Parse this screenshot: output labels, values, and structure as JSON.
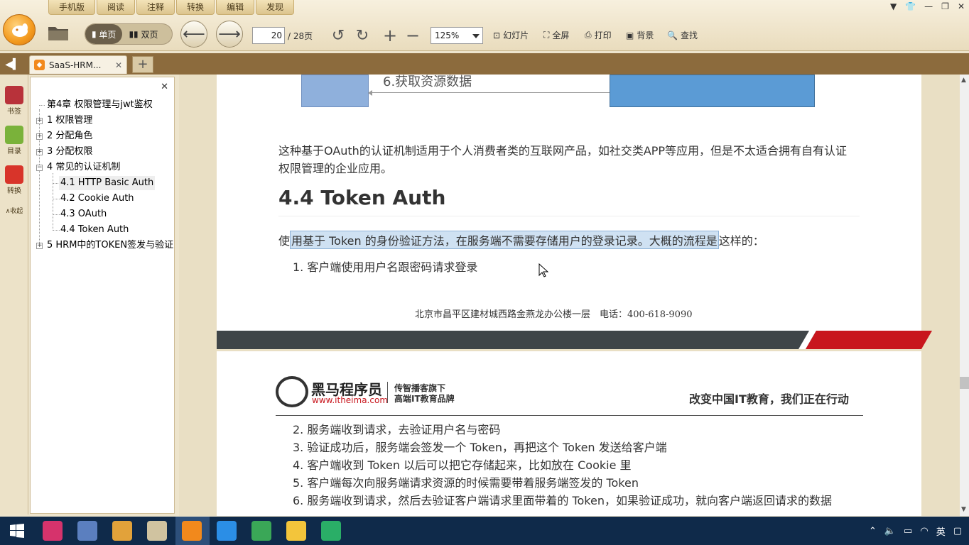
{
  "menu": [
    "手机版",
    "阅读",
    "注释",
    "转换",
    "编辑",
    "发现"
  ],
  "toolbar": {
    "single_page": "单页",
    "double_page": "双页",
    "page_current": "20",
    "page_total": "/ 28页",
    "zoom": "125%",
    "slideshow": "幻灯片",
    "fullscreen": "全屏",
    "print": "打印",
    "background": "背景",
    "find": "查找"
  },
  "tab": {
    "title": "SaaS-HRM...",
    "close": "✕",
    "new": "+"
  },
  "rail": [
    {
      "label": "书签",
      "color": "#b8323a"
    },
    {
      "label": "目录",
      "color": "#7ab23a"
    },
    {
      "label": "转换",
      "color": "#d8342a"
    },
    {
      "label": "收起"
    }
  ],
  "toc": {
    "close": "✕",
    "items": [
      {
        "label": "第4章 权限管理与jwt鉴权"
      },
      {
        "label": "1 权限管理",
        "expander": "+"
      },
      {
        "label": "2 分配角色",
        "expander": "+"
      },
      {
        "label": "3 分配权限",
        "expander": "+"
      },
      {
        "label": "4 常见的认证机制",
        "expander": "−"
      },
      {
        "label": "4.1 HTTP Basic Auth"
      },
      {
        "label": "4.2 Cookie Auth"
      },
      {
        "label": "4.3 OAuth"
      },
      {
        "label": "4.4 Token Auth"
      },
      {
        "label": "5 HRM中的TOKEN签发与验证",
        "expander": "+"
      }
    ]
  },
  "doc": {
    "diagram_label": "6.获取资源数据",
    "para1_line1": "这种基于OAuth的认证机制适用于个人消费者类的互联网产品，如社交类APP等应用，但是不太适合拥有自有认证",
    "para1_line2": "权限管理的企业应用。",
    "heading": "4.4 Token Auth",
    "para2_pre": "使",
    "para2_highlight": "用基于 Token 的身份验证方法，在服务端不需要存储用户的登录记录。大概的流程是",
    "para2_post": "这样的：",
    "step1": "1. 客户端使用用户名跟密码请求登录",
    "footer_address": "北京市昌平区建材城西路金燕龙办公楼一层　电话：400-618-9090",
    "brand_name": "黑马程序员",
    "brand_url": "www.itheima.com",
    "brand_sub1": "传智播客旗下",
    "brand_sub2": "高端IT教育品牌",
    "slogan": "改变中国IT教育，我们正在行动",
    "steps": [
      "2. 服务端收到请求，去验证用户名与密码",
      "3. 验证成功后，服务端会签发一个 Token，再把这个 Token 发送给客户端",
      "4. 客户端收到 Token 以后可以把它存储起来，比如放在 Cookie 里",
      "5. 客户端每次向服务端请求资源的时候需要带着服务端签发的 Token",
      "6. 服务端收到请求，然后去验证客户端请求里面带着的 Token，如果验证成功，就向客户端返回请求的数据"
    ]
  },
  "taskbar": {
    "icons": [
      {
        "name": "intellij-icon",
        "color": "#d6336c"
      },
      {
        "name": "dolphin-icon",
        "color": "#5b7fbf"
      },
      {
        "name": "books-icon",
        "color": "#e2a23a"
      },
      {
        "name": "paint-icon",
        "color": "#d0c3a0"
      },
      {
        "name": "foxit-icon",
        "color": "#f2891c"
      },
      {
        "name": "vscode-icon",
        "color": "#2b8ee6"
      },
      {
        "name": "chrome-icon",
        "color": "#3aa757"
      },
      {
        "name": "explorer-icon",
        "color": "#f3c53b"
      },
      {
        "name": "wechat-icon",
        "color": "#2aae67"
      }
    ],
    "ime": "英"
  }
}
